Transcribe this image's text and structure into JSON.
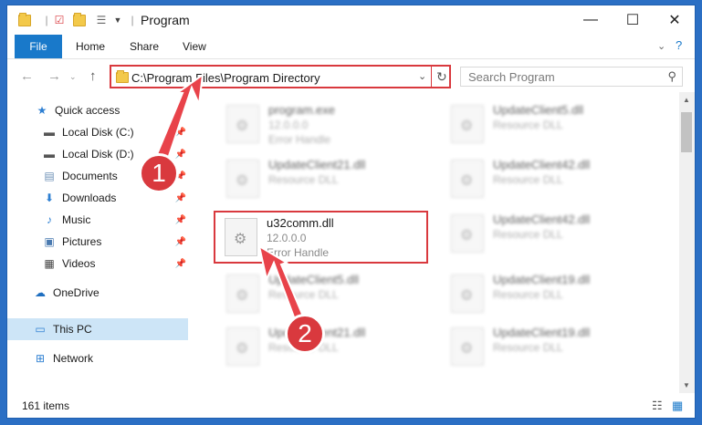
{
  "window": {
    "title": "Program",
    "minimize": "—",
    "maximize": "☐",
    "close": "✕"
  },
  "ribbon": {
    "file": "File",
    "home": "Home",
    "share": "Share",
    "view": "View"
  },
  "address": {
    "path": "C:\\Program Files\\Program Directory",
    "search_placeholder": "Search Program"
  },
  "nav": {
    "quick_access": "Quick access",
    "local_c": "Local Disk (C:)",
    "local_d": "Local Disk (D:)",
    "documents": "Documents",
    "downloads": "Downloads",
    "music": "Music",
    "pictures": "Pictures",
    "videos": "Videos",
    "onedrive": "OneDrive",
    "this_pc": "This PC",
    "network": "Network"
  },
  "files": {
    "f1": {
      "name": "program.exe",
      "version": "12.0.0.0",
      "type": "Error Handle"
    },
    "f2": {
      "name": "UpdateClient5.dll",
      "type": "Resource DLL"
    },
    "f3": {
      "name": "UpdateClient21.dll",
      "type": "Resource DLL"
    },
    "f4": {
      "name": "UpdateClient42.dll",
      "type": "Resource DLL"
    },
    "f5": {
      "name": "u32comm.dll",
      "version": "12.0.0.0",
      "type": "Error Handle"
    },
    "f6": {
      "name": "UpdateClient42.dll",
      "type": "Resource DLL"
    },
    "f7": {
      "name": "UpdateClient5.dll",
      "type": "Resource DLL"
    },
    "f8": {
      "name": "UpdateClient19.dll",
      "type": "Resource DLL"
    },
    "f9": {
      "name": "UpdateClient21.dll",
      "type": "Resource DLL"
    },
    "f10": {
      "name": "UpdateClient19.dll",
      "type": "Resource DLL"
    }
  },
  "status": {
    "items": "161 items"
  },
  "annotations": {
    "step1": "1",
    "step2": "2"
  },
  "colors": {
    "accent": "#1979ca",
    "highlight": "#d9393e"
  }
}
